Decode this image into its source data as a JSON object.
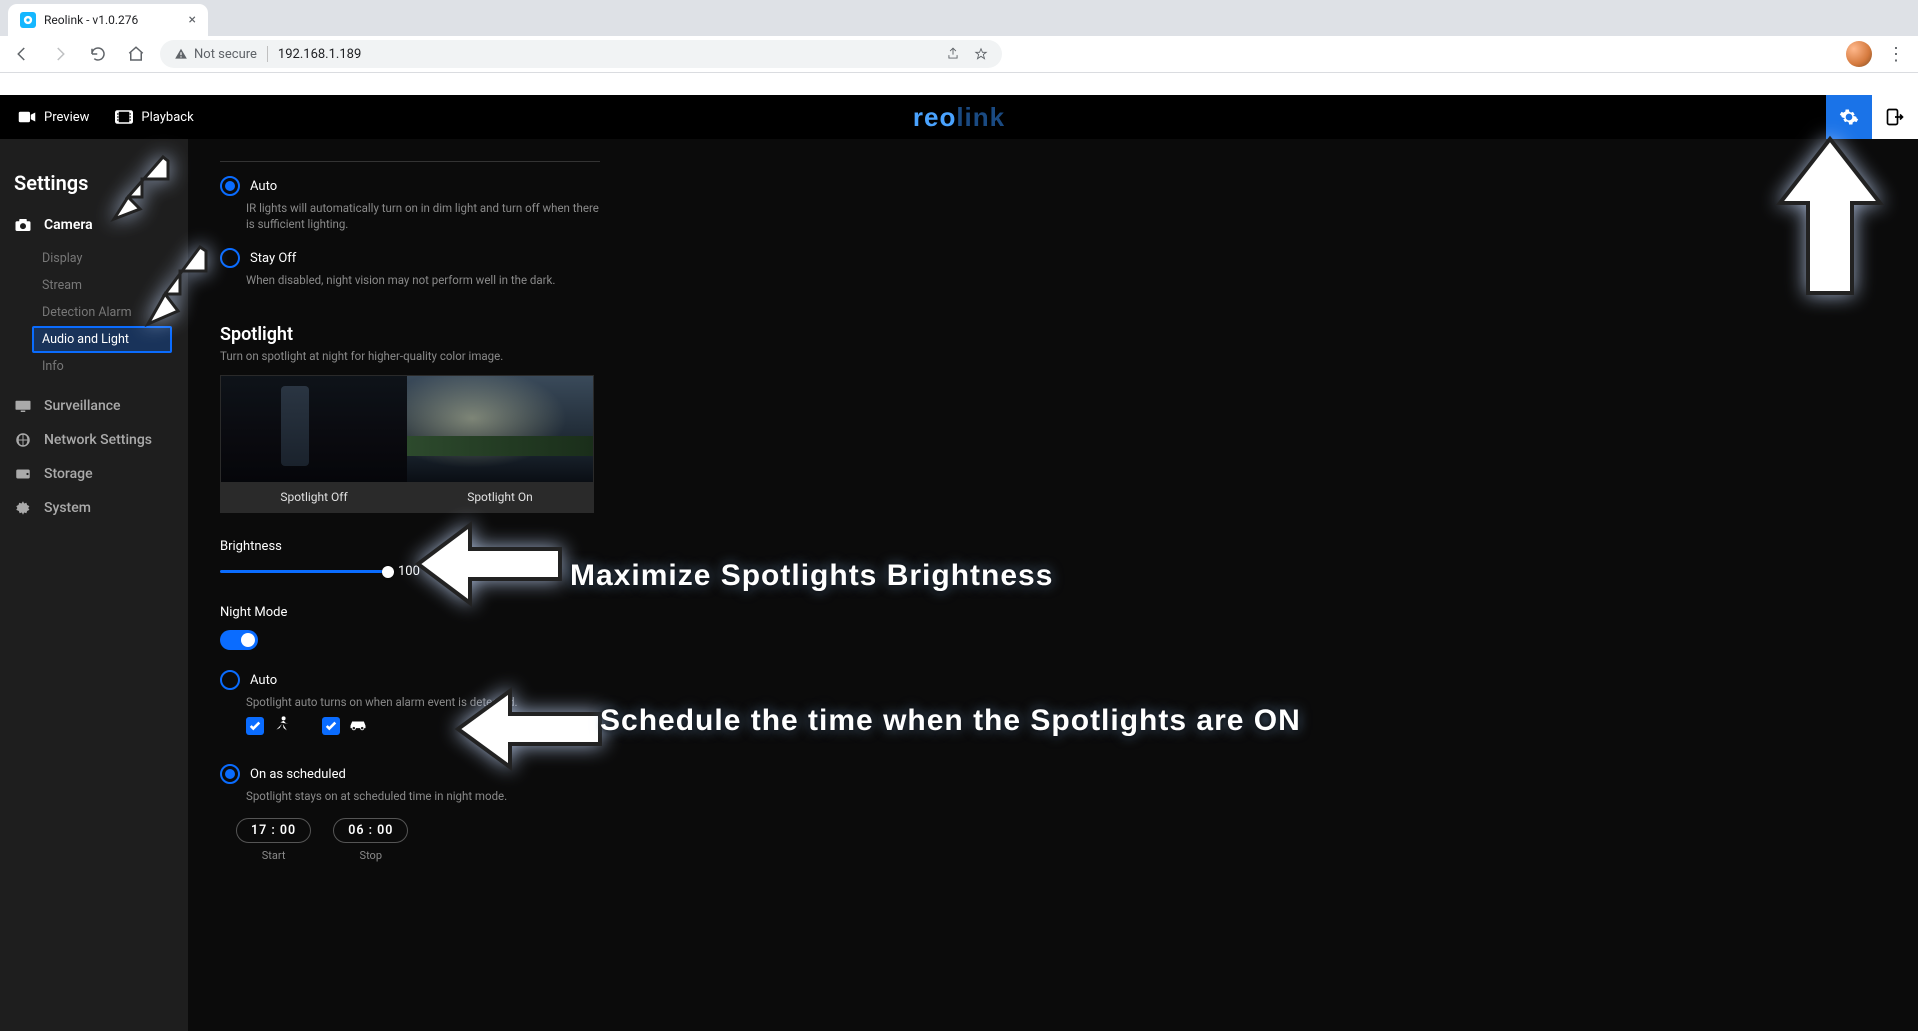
{
  "browser": {
    "tab_title": "Reolink - v1.0.276",
    "not_secure": "Not secure",
    "url": "192.168.1.189"
  },
  "app_header": {
    "preview": "Preview",
    "playback": "Playback",
    "logo_part1": "reo",
    "logo_part2": "link"
  },
  "sidebar": {
    "title": "Settings",
    "camera": "Camera",
    "items": {
      "display": "Display",
      "stream": "Stream",
      "detection": "Detection Alarm",
      "audio_light": "Audio and Light",
      "info": "Info"
    },
    "surveillance": "Surveillance",
    "network": "Network Settings",
    "storage": "Storage",
    "system": "System"
  },
  "ir": {
    "auto": "Auto",
    "auto_desc": "IR lights will automatically turn on in dim light and turn off when there is sufficient lighting.",
    "stayoff": "Stay Off",
    "stayoff_desc": "When disabled, night vision may not perform well in the dark."
  },
  "spotlight": {
    "title": "Spotlight",
    "desc": "Turn on spotlight at night for higher-quality color image.",
    "off_label": "Spotlight Off",
    "on_label": "Spotlight On",
    "brightness_label": "Brightness",
    "brightness_value": "100",
    "night_mode": "Night Mode",
    "auto": "Auto",
    "auto_desc": "Spotlight auto turns on when alarm event is detected.",
    "scheduled": "On as scheduled",
    "scheduled_desc": "Spotlight stays on at scheduled time in night mode.",
    "start_time": "17 : 00",
    "stop_time": "06 : 00",
    "start_label": "Start",
    "stop_label": "Stop"
  },
  "callouts": {
    "c1": "Maximize Spotlights Brightness",
    "c2": "Schedule the time when the Spotlights are ON"
  }
}
